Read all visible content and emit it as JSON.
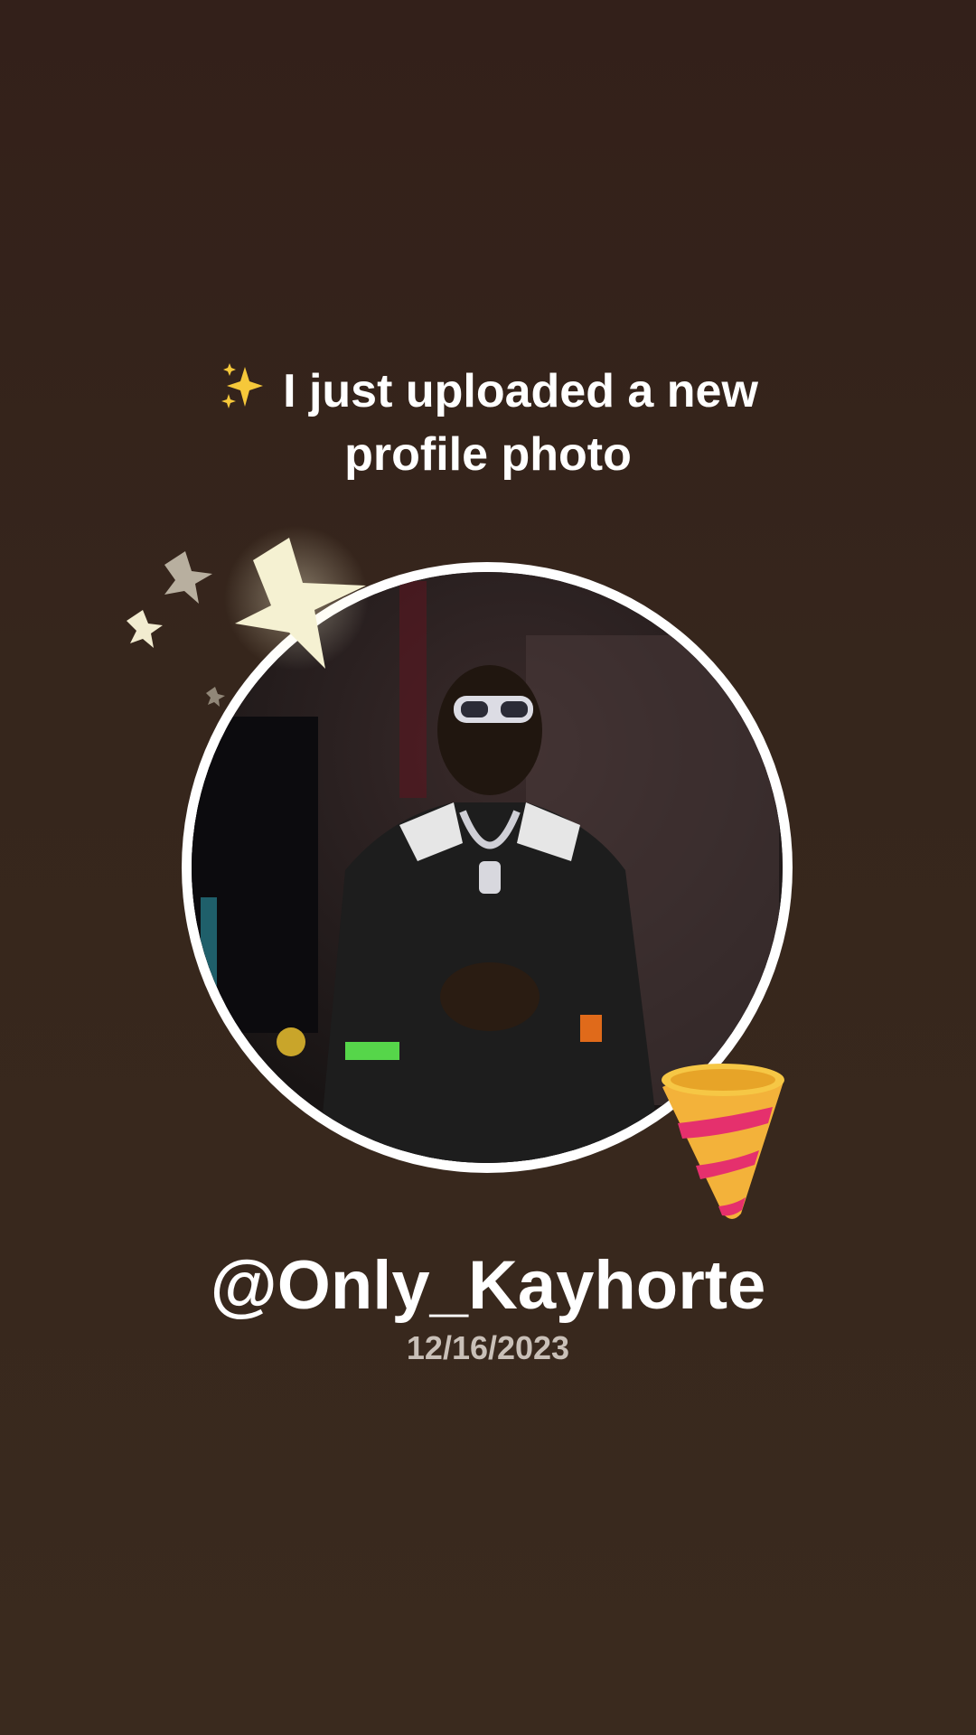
{
  "headline": {
    "line1": "I just uploaded a new",
    "line2": "profile photo",
    "leading_icon": "sparkles-icon"
  },
  "profile": {
    "username": "@Only_Kayhorte",
    "date": "12/16/2023",
    "photo_icon": "profile-photo"
  },
  "decorations": {
    "stars": "stars-icon",
    "party": "party-popper-icon"
  },
  "colors": {
    "background_top": "#33201a",
    "background_bottom": "#3a2a1e",
    "text": "#ffffff",
    "date_text": "#c9c0b8",
    "ring": "#ffffff"
  }
}
